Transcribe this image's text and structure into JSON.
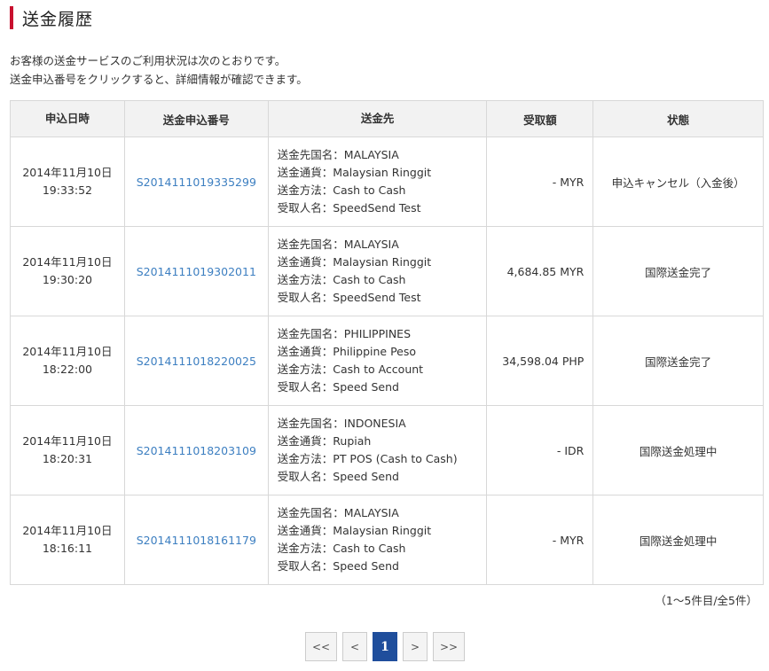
{
  "page": {
    "title": "送金履歴",
    "intro_line1": "お客様の送金サービスのご利用状況は次のとおりです。",
    "intro_line2": "送金申込番号をクリックすると、詳細情報が確認できます。"
  },
  "table": {
    "headers": {
      "date": "申込日時",
      "number": "送金申込番号",
      "destination": "送金先",
      "amount": "受取額",
      "status": "状態"
    },
    "rows": [
      {
        "date": "2014年11月10日",
        "time": "19:33:52",
        "number": "S2014111019335299",
        "country": "送金先国名：MALAYSIA",
        "currency": "送金通貨：Malaysian Ringgit",
        "method": "送金方法：Cash to Cash",
        "recipient": "受取人名：SpeedSend Test",
        "amount": "- MYR",
        "status": "申込キャンセル（入金後）"
      },
      {
        "date": "2014年11月10日",
        "time": "19:30:20",
        "number": "S2014111019302011",
        "country": "送金先国名：MALAYSIA",
        "currency": "送金通貨：Malaysian Ringgit",
        "method": "送金方法：Cash to Cash",
        "recipient": "受取人名：SpeedSend Test",
        "amount": "4,684.85 MYR",
        "status": "国際送金完了"
      },
      {
        "date": "2014年11月10日",
        "time": "18:22:00",
        "number": "S2014111018220025",
        "country": "送金先国名：PHILIPPINES",
        "currency": "送金通貨：Philippine Peso",
        "method": "送金方法：Cash to Account",
        "recipient": "受取人名：Speed Send",
        "amount": "34,598.04 PHP",
        "status": "国際送金完了"
      },
      {
        "date": "2014年11月10日",
        "time": "18:20:31",
        "number": "S2014111018203109",
        "country": "送金先国名：INDONESIA",
        "currency": "送金通貨：Rupiah",
        "method": "送金方法：PT POS (Cash to Cash)",
        "recipient": "受取人名：Speed Send",
        "amount": "- IDR",
        "status": "国際送金処理中"
      },
      {
        "date": "2014年11月10日",
        "time": "18:16:11",
        "number": "S2014111018161179",
        "country": "送金先国名：MALAYSIA",
        "currency": "送金通貨：Malaysian Ringgit",
        "method": "送金方法：Cash to Cash",
        "recipient": "受取人名：Speed Send",
        "amount": "- MYR",
        "status": "国際送金処理中"
      }
    ]
  },
  "pagination": {
    "count_text": "（1～5件目/全5件）",
    "first": "<<",
    "prev": "<",
    "current": "1",
    "next": ">",
    "last": ">>"
  },
  "colors": {
    "accent": "#c8102e",
    "link": "#3d7fc1",
    "active_page": "#1f4e9c"
  }
}
